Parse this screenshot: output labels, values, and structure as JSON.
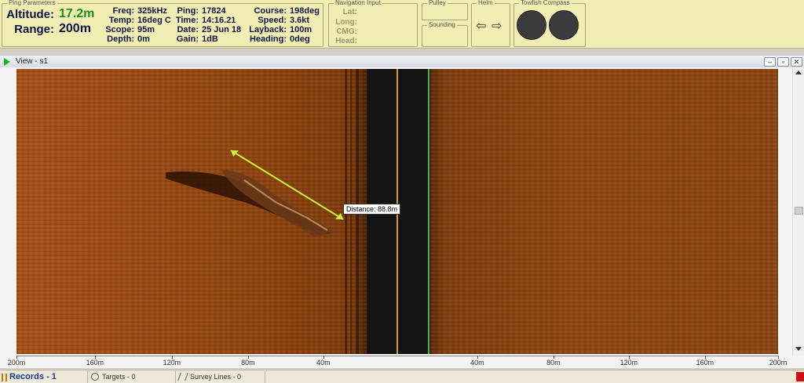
{
  "ping_parameters": {
    "group_title": "Ping Parameters",
    "altitude_label": "Altitude:",
    "altitude_value": "17.2m",
    "range_label": "Range:",
    "range_value": "200m",
    "col1": [
      {
        "label": "Freq:",
        "value": "325kHz"
      },
      {
        "label": "Temp:",
        "value": "16deg C"
      },
      {
        "label": "Scope:",
        "value": "95m"
      },
      {
        "label": "Depth:",
        "value": "0m"
      }
    ],
    "col2": [
      {
        "label": "Ping:",
        "value": "17824"
      },
      {
        "label": "Time:",
        "value": "14:16.21"
      },
      {
        "label": "Date:",
        "value": "25 Jun 18"
      },
      {
        "label": "Gain:",
        "value": "1dB"
      }
    ],
    "col3": [
      {
        "label": "Course:",
        "value": "198deg"
      },
      {
        "label": "Speed:",
        "value": "3.6kt"
      },
      {
        "label": "Layback:",
        "value": "100m"
      },
      {
        "label": "Heading:",
        "value": "0deg"
      }
    ]
  },
  "navigation_input": {
    "group_title": "Navigation Input",
    "fields": [
      "Lat:",
      "Long:",
      "CMG:",
      "Head:"
    ]
  },
  "pulley": {
    "group_title": "Pulley"
  },
  "sounding": {
    "group_title": "Sounding"
  },
  "helm": {
    "group_title": "Helm",
    "left_arrow": "⇦",
    "right_arrow": "⇨"
  },
  "towfish_compass": {
    "group_title": "Towfish Compass"
  },
  "view": {
    "title": "View - s1",
    "minimize": "–",
    "restore": "▫",
    "close": "✕",
    "measurement_label": "Distance: 88.8m",
    "colors": {
      "measure_line": "#c8f03c",
      "nadir": "#d99a1c",
      "seabed_trace": "#4fb82a"
    }
  },
  "range_axis": {
    "ticks": [
      {
        "label": "200m",
        "pos": 0.0
      },
      {
        "label": "160m",
        "pos": 0.103
      },
      {
        "label": "120m",
        "pos": 0.204
      },
      {
        "label": "80m",
        "pos": 0.304
      },
      {
        "label": "40m",
        "pos": 0.403
      },
      {
        "label": "40m",
        "pos": 0.605
      },
      {
        "label": "80m",
        "pos": 0.705
      },
      {
        "label": "120m",
        "pos": 0.804
      },
      {
        "label": "160m",
        "pos": 0.904
      },
      {
        "label": "200m",
        "pos": 1.0
      }
    ]
  },
  "status_bar": {
    "records": "Records - 1",
    "targets": "Targets - 0",
    "survey_lines": "Survey Lines - 0"
  }
}
